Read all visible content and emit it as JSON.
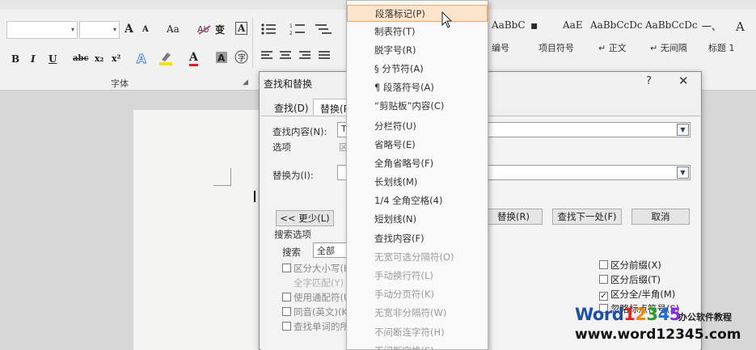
{
  "ribbon": {
    "font_group_label": "字体",
    "font_tools": {
      "grow": "A",
      "shrink": "A",
      "change_case": "Aa",
      "phonetic": "变",
      "border_char": "A",
      "bold": "B",
      "italic": "I",
      "underline": "U",
      "strike": "abc",
      "subscript": "x₂",
      "superscript": "x²",
      "font_color": "A"
    },
    "styles": [
      {
        "sample": "AaBbC",
        "label": ""
      },
      {
        "sample": "▪",
        "label": "编号"
      },
      {
        "sample": "AaE",
        "label": "项目符号"
      },
      {
        "sample": "AaBbCcDc",
        "label": "↵ 正文"
      },
      {
        "sample": "AaBbCcDc",
        "label": "↵ 无间隔"
      },
      {
        "sample": "一、",
        "label": "标题 1"
      },
      {
        "sample": "A",
        "label": ""
      }
    ]
  },
  "dialog": {
    "title": "查找和替换",
    "help": "?",
    "close": "✕",
    "tabs": [
      "查找(D)",
      "替换(P)"
    ],
    "find_label": "查找内容(N):",
    "find_value": "T",
    "options_label": "选项",
    "options_value": "区",
    "replace_label": "替换为(I):",
    "less_button": "<< 更少(L)",
    "replace_button": "替换(R)",
    "find_next_button": "查找下一处(F)",
    "cancel_button": "取消",
    "search_options_label": "搜索选项",
    "search_label": "搜索",
    "search_value": "全部",
    "left_checks": [
      {
        "label": "区分大小写(H)",
        "checked": false
      },
      {
        "label": "全字匹配(Y)",
        "checked": false,
        "disabled": true
      },
      {
        "label": "使用通配符(U)",
        "checked": false
      },
      {
        "label": "同音(英文)(K)",
        "checked": false
      },
      {
        "label": "查找单词的所有形式(英文)(W)",
        "checked": false
      }
    ],
    "right_checks": [
      {
        "label": "区分前缀(X)",
        "checked": false
      },
      {
        "label": "区分后缀(T)",
        "checked": false
      },
      {
        "label": "区分全/半角(M)",
        "checked": true
      },
      {
        "label": "忽略标点符号(S)",
        "checked": false
      }
    ]
  },
  "special_menu": {
    "items": [
      {
        "label": "段落标记(P)",
        "state": "highlighted"
      },
      {
        "label": "制表符(T)",
        "state": "normal"
      },
      {
        "label": "脱字号(R)",
        "state": "normal"
      },
      {
        "label": "§ 分节符(A)",
        "state": "normal"
      },
      {
        "label": "¶ 段落符号(A)",
        "state": "normal"
      },
      {
        "label": "“剪贴板”内容(C)",
        "state": "normal"
      },
      {
        "label": "分栏符(U)",
        "state": "normal"
      },
      {
        "label": "省略号(E)",
        "state": "normal"
      },
      {
        "label": "全角省略号(F)",
        "state": "normal"
      },
      {
        "label": "长划线(M)",
        "state": "normal"
      },
      {
        "label": "1/4 全角空格(4)",
        "state": "normal"
      },
      {
        "label": "短划线(N)",
        "state": "normal"
      },
      {
        "label": "查找内容(F)",
        "state": "normal"
      },
      {
        "label": "无宽可选分隔符(O)",
        "state": "disabled"
      },
      {
        "label": "手动换行符(L)",
        "state": "disabled"
      },
      {
        "label": "手动分页符(K)",
        "state": "disabled"
      },
      {
        "label": "无宽非分隔符(W)",
        "state": "disabled"
      },
      {
        "label": "不间断连字符(H)",
        "state": "disabled"
      },
      {
        "label": "不间断空格(S)",
        "state": "disabled"
      }
    ]
  },
  "watermark": {
    "logo_word": "Word",
    "logo_digits": [
      "1",
      "2",
      "3",
      "4",
      "5"
    ],
    "tagline": "办公软件教程",
    "url": "www.word12345.com"
  },
  "colors": {
    "menu_highlight": "#fde4cd",
    "menu_highlight_border": "#e8a66a",
    "logo_blue": "#1f4ea6"
  }
}
